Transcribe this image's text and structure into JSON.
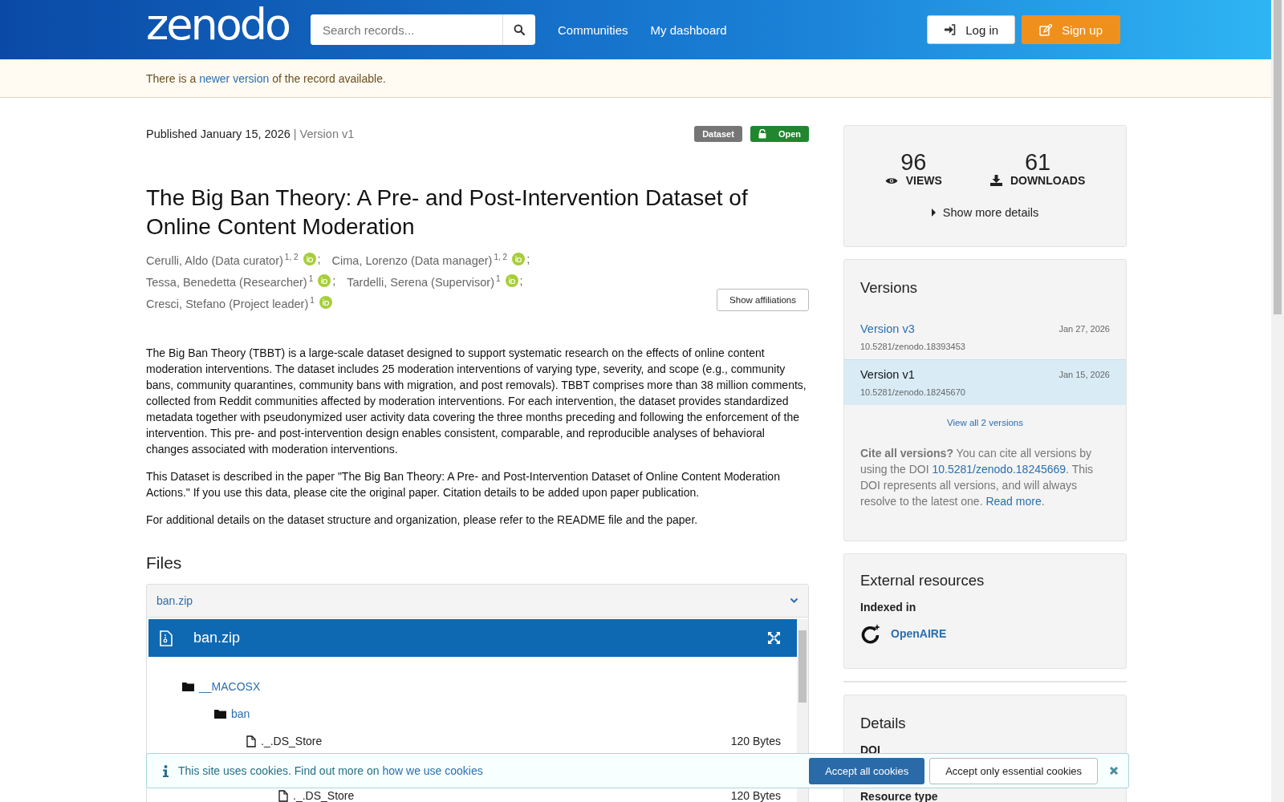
{
  "header": {
    "logo": "zenodo",
    "search": {
      "placeholder": "Search records..."
    },
    "nav": [
      "Communities",
      "My dashboard"
    ],
    "login": "Log in",
    "signup": "Sign up"
  },
  "notice": {
    "before": "There is a",
    "link": "newer version",
    "after": "of the record available."
  },
  "record": {
    "published": "Published January 15, 2026",
    "version": "| Version v1",
    "badges": [
      {
        "kind": "type",
        "label": "Dataset"
      },
      {
        "kind": "access",
        "label": "Open"
      }
    ],
    "title": "The Big Ban Theory: A Pre- and Post-Intervention Dataset of Online Content Moderation",
    "creator_lines": [
      [
        {
          "name": "Cerulli, Aldo (Data curator)",
          "affiliations": "1, 2",
          "sep": ";"
        },
        {
          "name": "Cima, Lorenzo (Data manager)",
          "affiliations": "1, 2",
          "sep": ";"
        }
      ],
      [
        {
          "name": "Tessa, Benedetta (Researcher)",
          "affiliations": "1",
          "sep": ";"
        },
        {
          "name": "Tardelli, Serena (Supervisor)",
          "affiliations": "1",
          "sep": ";"
        }
      ],
      [
        {
          "name": "Cresci, Stefano (Project leader)",
          "affiliations": "1"
        }
      ]
    ],
    "show_affiliations": "Show affiliations",
    "description": [
      "The Big Ban Theory (TBBT) is a large-scale dataset designed to support systematic research on the effects of online content moderation interventions. The dataset includes 25 moderation interventions of varying type, severity, and scope (e.g., community bans, community quarantines, community bans with migration, and post removals). TBBT comprises more than 38 million comments, collected from Reddit communities affected by moderation interventions. For each intervention, the dataset provides standardized metadata together with pseudonymized user activity data covering the three months preceding and following the enforcement of the intervention. This pre- and post-intervention design enables consistent, comparable, and reproducible analyses of behavioral changes associated with moderation interventions.",
      "This Dataset is described in the paper \"The Big Ban Theory: A Pre- and Post-Intervention Dataset of Online Content Moderation Actions.\" If you use this data, please cite the original paper. Citation details to be added upon paper publication.",
      "For additional details on the dataset structure and organization, please refer to the README file and the paper."
    ]
  },
  "files": {
    "heading": "Files",
    "accordion": {
      "label": "ban.zip",
      "expanded": true
    },
    "preview_title": "ban.zip",
    "tree": [
      {
        "kind": "folder",
        "name": "__MACOSX",
        "children": [
          {
            "kind": "folder",
            "name": "ban",
            "children": [
              {
                "kind": "file",
                "name": "._.DS_Store",
                "size": "120 Bytes"
              },
              {
                "children": [
                  {
                    "kind": "file",
                    "name": "._.DS_Store",
                    "size": "120 Bytes"
                  }
                ]
              }
            ]
          }
        ]
      }
    ]
  },
  "stats": {
    "views": "96",
    "views_label": "VIEWS",
    "downloads": "61",
    "downloads_label": "DOWNLOADS",
    "more": "Show more details"
  },
  "versions": {
    "heading": "Versions",
    "items": [
      {
        "label": "Version v3",
        "date": "Jan 27, 2026",
        "doi": "10.5281/zenodo.18393453",
        "selected": false
      },
      {
        "label": "Version v1",
        "date": "Jan 15, 2026",
        "doi": "10.5281/zenodo.18245670",
        "selected": true
      }
    ],
    "view_all": "View all 2 versions",
    "cite": "**Cite all versions?** You can cite all versions by using the DOI",
    "cite_doi": "10.5281/zenodo.18245669",
    "cite_after": ". This DOI represents all versions, and will always resolve to the latest one.",
    "read_more": "Read more",
    "read_more_after": "."
  },
  "external": {
    "heading": "External resources",
    "indexed_in": "Indexed in",
    "items": [
      "OpenAIRE"
    ]
  },
  "details": {
    "heading": "Details",
    "fields": [
      "DOI",
      "Resource type"
    ]
  },
  "cookies": {
    "text": "This site uses cookies. Find out more on",
    "link": "how we use cookies",
    "accept_all": "Accept all cookies",
    "accept_essential": "Accept only essential cookies"
  }
}
